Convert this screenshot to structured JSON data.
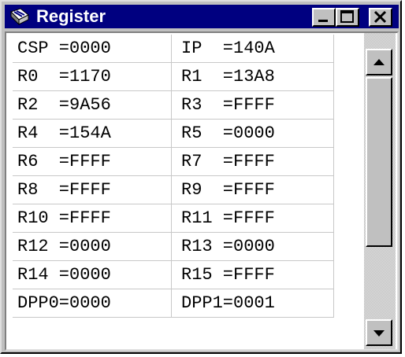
{
  "window": {
    "title": "Register"
  },
  "title_buttons": {
    "minimize_icon": "minimize-icon",
    "maximize_icon": "maximize-icon",
    "close_icon": "close-icon"
  },
  "registers": [
    {
      "left": "CSP =0000",
      "right": "IP  =140A"
    },
    {
      "left": "R0  =1170",
      "right": "R1  =13A8"
    },
    {
      "left": "R2  =9A56",
      "right": "R3  =FFFF"
    },
    {
      "left": "R4  =154A",
      "right": "R5  =0000"
    },
    {
      "left": "R6  =FFFF",
      "right": "R7  =FFFF"
    },
    {
      "left": "R8  =FFFF",
      "right": "R9  =FFFF"
    },
    {
      "left": "R10 =FFFF",
      "right": "R11 =FFFF"
    },
    {
      "left": "R12 =0000",
      "right": "R13 =0000"
    },
    {
      "left": "R14 =0000",
      "right": "R15 =FFFF"
    },
    {
      "left": "DPP0=0000",
      "right": "DPP1=0001"
    }
  ],
  "scrollbar": {
    "up_icon": "scroll-up-arrow-icon",
    "down_icon": "scroll-down-arrow-icon"
  },
  "colors": {
    "titlebar": "#000080",
    "face": "#c0c0c0",
    "grid_line": "#c8c8c8"
  }
}
